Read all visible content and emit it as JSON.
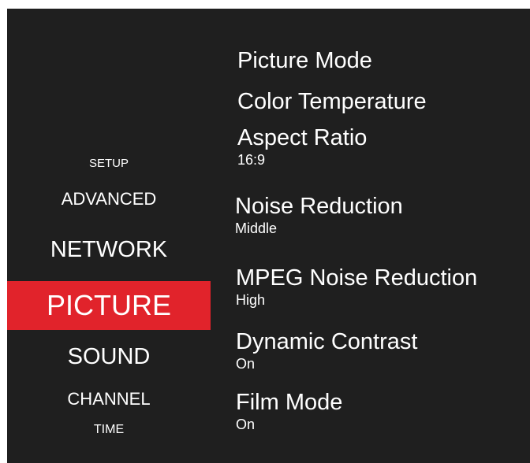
{
  "menu": {
    "categories": [
      {
        "label": "SETUP"
      },
      {
        "label": "ADVANCED"
      },
      {
        "label": "NETWORK"
      },
      {
        "label": "PICTURE"
      },
      {
        "label": "SOUND"
      },
      {
        "label": "CHANNEL"
      },
      {
        "label": "TIME"
      }
    ],
    "selected": "PICTURE",
    "highlight_color": "#e1232b",
    "background_color": "#1f1f1f"
  },
  "options": [
    {
      "label": "Picture Mode",
      "value": ""
    },
    {
      "label": "Color Temperature",
      "value": ""
    },
    {
      "label": "Aspect Ratio",
      "value": "16:9"
    },
    {
      "label": "Noise Reduction",
      "value": "Middle"
    },
    {
      "label": "MPEG Noise Reduction",
      "value": "High"
    },
    {
      "label": "Dynamic Contrast",
      "value": "On"
    },
    {
      "label": "Film Mode",
      "value": "On"
    }
  ]
}
